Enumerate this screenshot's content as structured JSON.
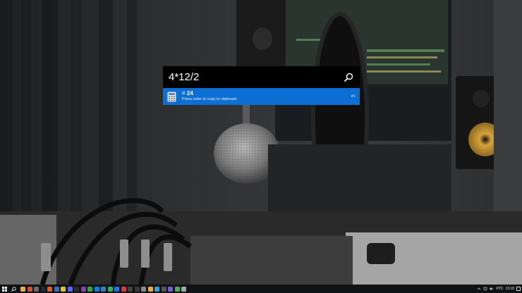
{
  "launcher": {
    "query": "4*12/2",
    "result": {
      "title": "= 24",
      "subtitle": "Press enter to copy to clipboard",
      "hotkey": "#1"
    }
  },
  "taskbar": {
    "apps": [
      {
        "name": "file-explorer-icon",
        "color": "#e8b03a"
      },
      {
        "name": "browser-icon",
        "color": "#e14a2a"
      },
      {
        "name": "settings-icon",
        "color": "#6c6c6c"
      },
      {
        "name": "steam-icon",
        "color": "#1e2a44"
      },
      {
        "name": "media-player-icon",
        "color": "#e35c1c"
      },
      {
        "name": "store-icon",
        "color": "#2f6fd6"
      },
      {
        "name": "notes-icon",
        "color": "#d9c23b"
      },
      {
        "name": "discord-icon",
        "color": "#5865f2"
      },
      {
        "name": "terminal-icon",
        "color": "#2b2b2b"
      },
      {
        "name": "photos-icon",
        "color": "#8a3dbd"
      },
      {
        "name": "maps-icon",
        "color": "#2aa84a"
      },
      {
        "name": "chat-icon",
        "color": "#0f7fd9"
      },
      {
        "name": "code-editor-icon",
        "color": "#2c7fcf"
      },
      {
        "name": "music-icon",
        "color": "#1db954"
      },
      {
        "name": "mail-icon",
        "color": "#1a73e8"
      },
      {
        "name": "calendar-icon",
        "color": "#d83b3b"
      },
      {
        "name": "camera-icon",
        "color": "#444"
      },
      {
        "name": "calculator-icon",
        "color": "#3a3a3a"
      },
      {
        "name": "video-icon",
        "color": "#8a8a8a"
      },
      {
        "name": "chrome-icon",
        "color": "#e8b03a"
      },
      {
        "name": "telegram-icon",
        "color": "#2aa3e0"
      },
      {
        "name": "app-icon",
        "color": "#555"
      },
      {
        "name": "app2-icon",
        "color": "#7b5bd6"
      },
      {
        "name": "app3-icon",
        "color": "#4caf50"
      },
      {
        "name": "app4-icon",
        "color": "#9aa"
      }
    ],
    "tray": {
      "language": "РУС",
      "time": "13:18"
    }
  }
}
